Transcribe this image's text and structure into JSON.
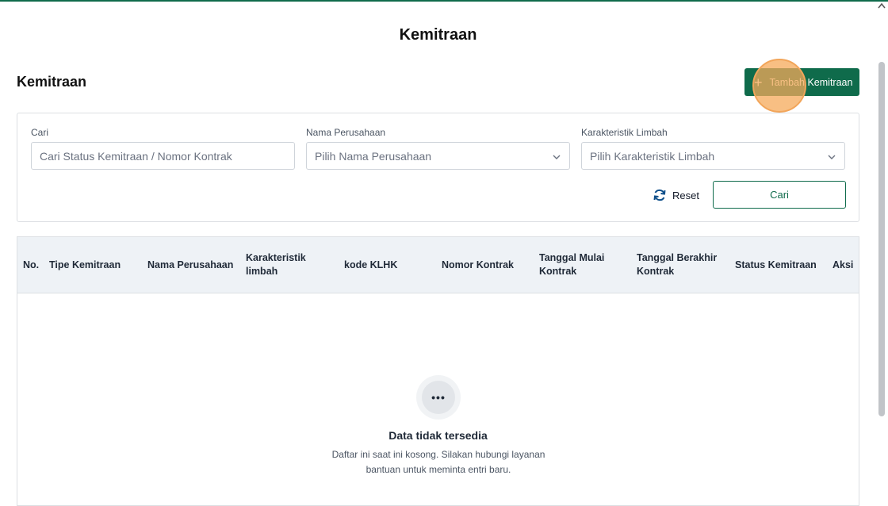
{
  "page": {
    "title": "Kemitraan"
  },
  "section": {
    "title": "Kemitraan",
    "add_button_label": "Tambah Kemitraan"
  },
  "filters": {
    "search": {
      "label": "Cari",
      "placeholder": "Cari Status Kemitraan / Nomor Kontrak",
      "value": ""
    },
    "company": {
      "label": "Nama Perusahaan",
      "placeholder": "Pilih Nama Perusahaan"
    },
    "waste": {
      "label": "Karakteristik Limbah",
      "placeholder": "Pilih Karakteristik Limbah"
    },
    "reset_label": "Reset",
    "search_button_label": "Cari"
  },
  "table": {
    "columns": [
      "No.",
      "Tipe Kemitraan",
      "Nama Perusahaan",
      "Karakteristik limbah",
      "kode KLHK",
      "Nomor Kontrak",
      "Tanggal Mulai Kontrak",
      "Tanggal Berakhir Kontrak",
      "Status Kemitraan",
      "Aksi"
    ],
    "rows": []
  },
  "empty_state": {
    "title": "Data tidak tersedia",
    "description": "Daftar ini saat ini kosong. Silakan hubungi layanan bantuan untuk meminta entri baru."
  },
  "icons": {
    "add": "plus-icon",
    "reset": "refresh-icon",
    "select": "chevron-down-icon",
    "empty": "more-horizontal-icon"
  },
  "colors": {
    "primary": "#0f6b4b",
    "header_bg": "#eef2f6",
    "cursor_highlight": "#f2a55a"
  }
}
